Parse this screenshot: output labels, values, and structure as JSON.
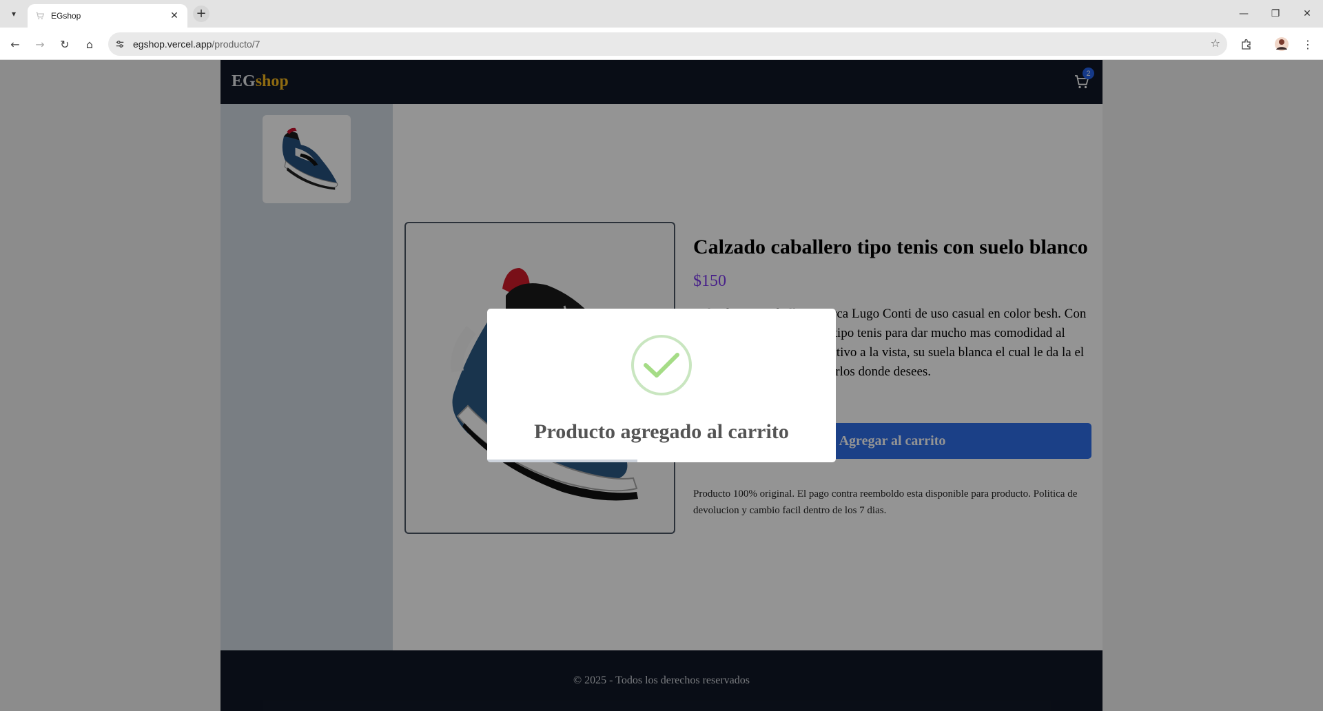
{
  "browser": {
    "tab_title": "EGshop",
    "url_host": "egshop.vercel.app",
    "url_path": "/producto/7",
    "icons": {
      "tab_list": "chevron-down-icon",
      "close_tab": "close-icon",
      "new_tab": "plus-icon",
      "back": "arrow-left-icon",
      "forward": "arrow-right-icon",
      "reload": "reload-icon",
      "home": "home-icon",
      "site_info": "tune-icon",
      "bookmark": "star-icon",
      "extensions": "puzzle-icon",
      "profile": "avatar",
      "menu": "kebab-menu-icon",
      "minimize": "minimize-icon",
      "restore": "restore-icon",
      "close_window": "close-icon"
    }
  },
  "site": {
    "logo_part1": "EG",
    "logo_part2": "shop",
    "cart_count": "2",
    "colors": {
      "header_bg": "#111827",
      "logo_accent": "#f6b81e",
      "price": "#7c3aed",
      "button": "#2f6fe8",
      "badge": "#2563eb"
    }
  },
  "product": {
    "title": "Calzado caballero tipo tenis con suelo blanco",
    "price": "$150",
    "description": "Calzado para caballero marca Lugo Conti de uso casual en color besh. Con diseño moderno de zapato tipo tenis para dar mucho mas comodidad al usuario con un diseño atractivo a la vista, su suela blanca el cual le da la el contraste perfecto para lucirlos donde desees.",
    "add_button": "Agregar al carrito",
    "note": "Producto 100% original. El pago contra reemboldo esta disponible para producto. Politica de devolucion y cambio facil dentro de los 7 dias."
  },
  "footer": {
    "text": "© 2025 - Todos los derechos reservados"
  },
  "modal": {
    "title": "Producto agregado al carrito",
    "icon": "check-icon",
    "timer_progress_percent": 43
  }
}
